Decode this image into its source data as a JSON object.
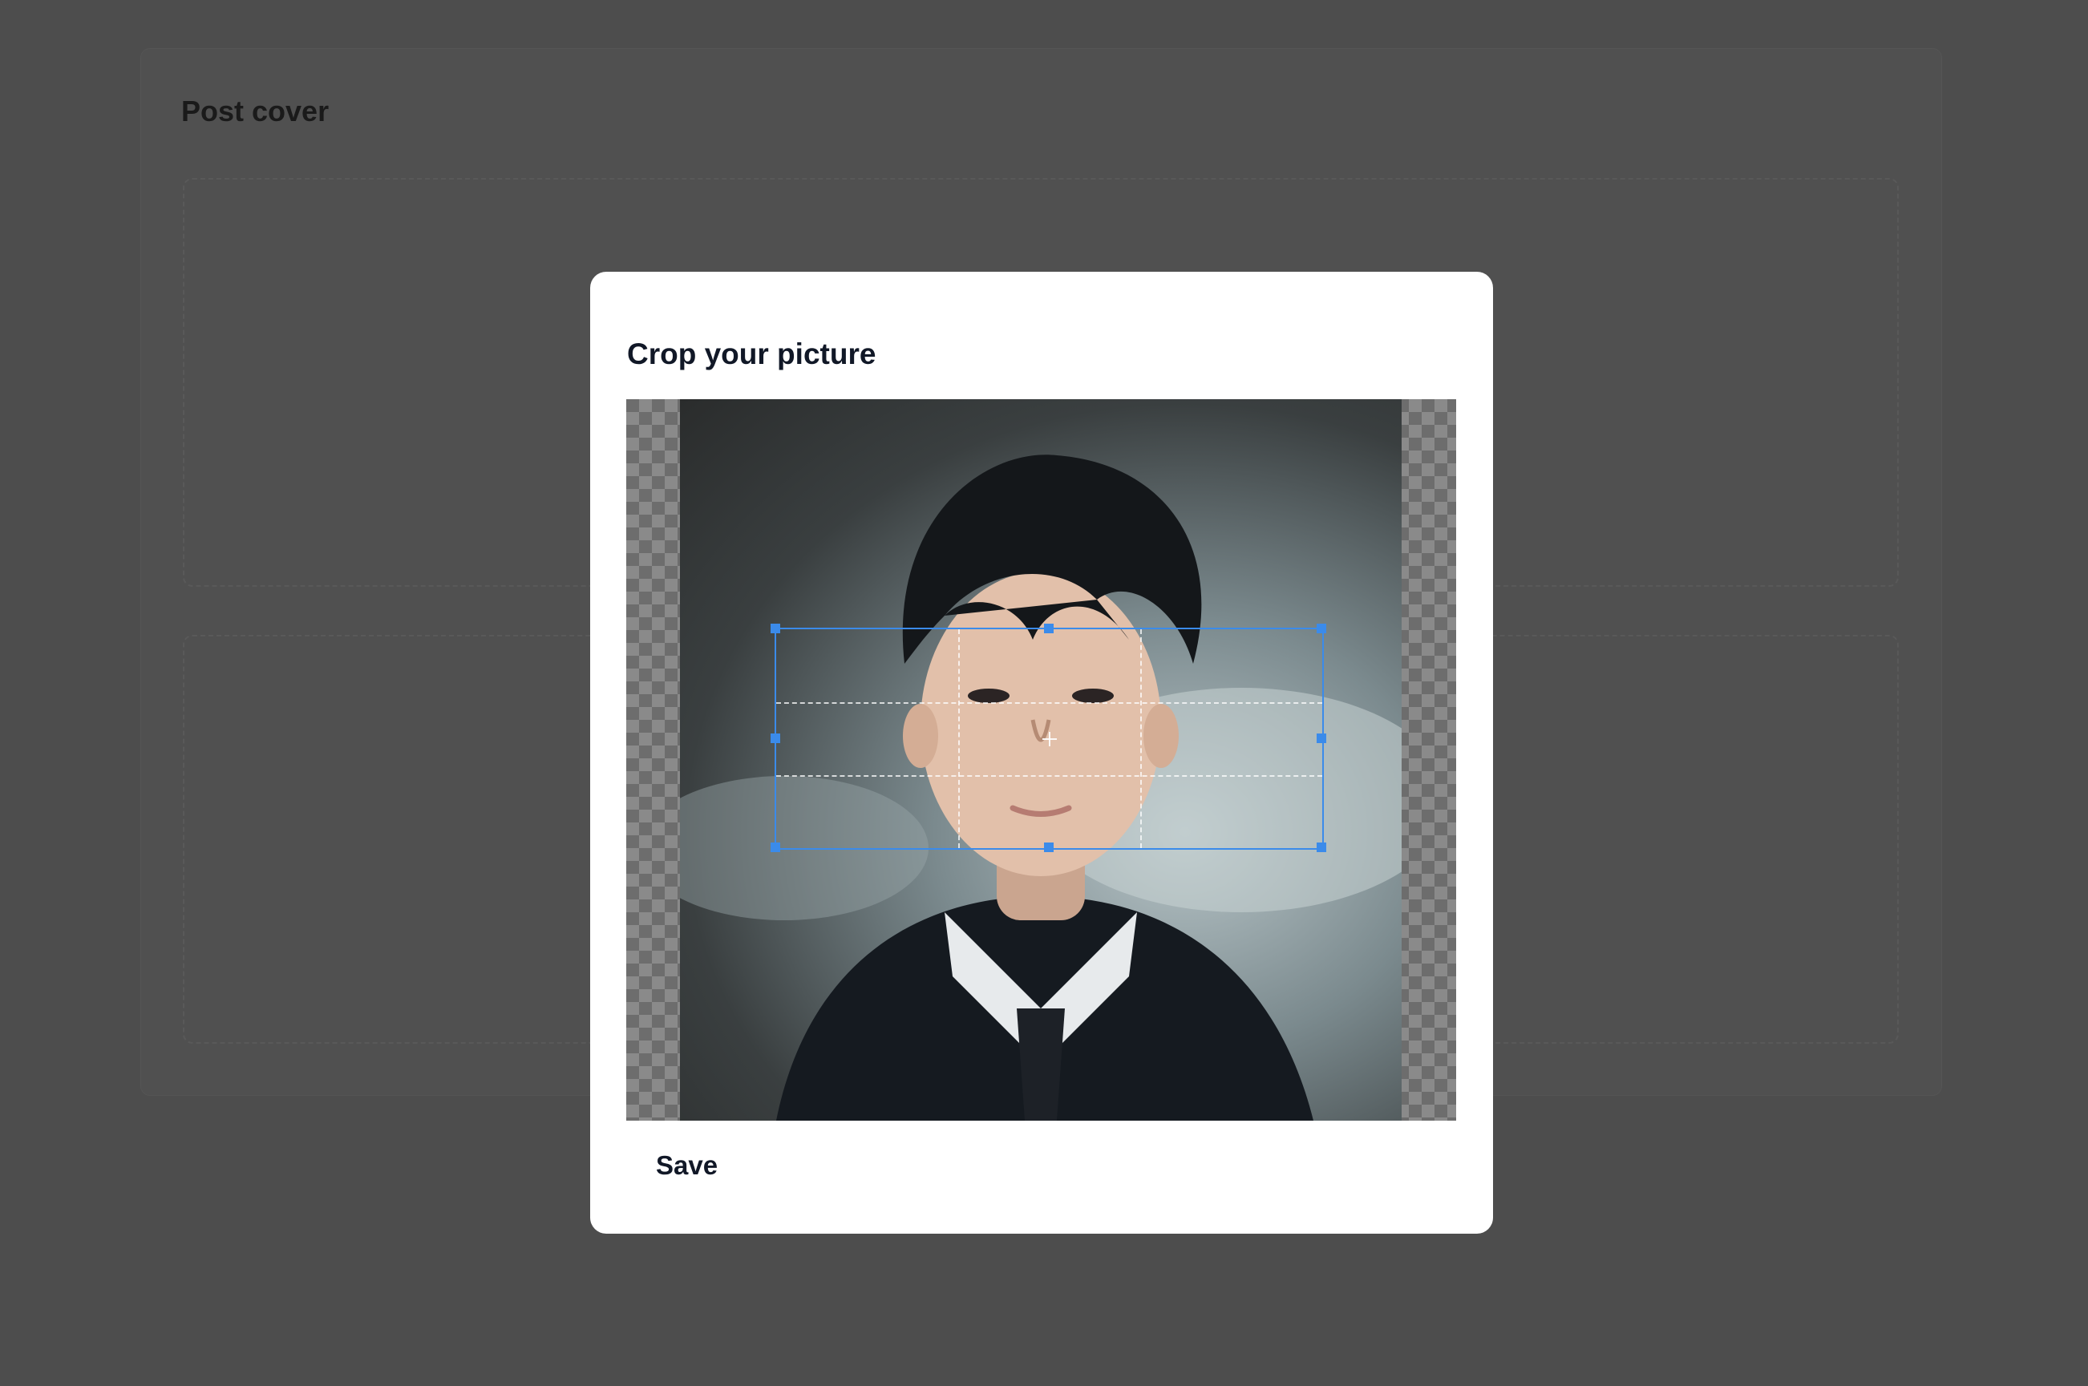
{
  "page": {
    "title": "Post cover",
    "backdrop_color": "#4d4d4d"
  },
  "modal": {
    "title": "Crop your picture",
    "save_label": "Save",
    "image_description_icon": "portrait-image",
    "accent_color": "#3b8bea"
  }
}
